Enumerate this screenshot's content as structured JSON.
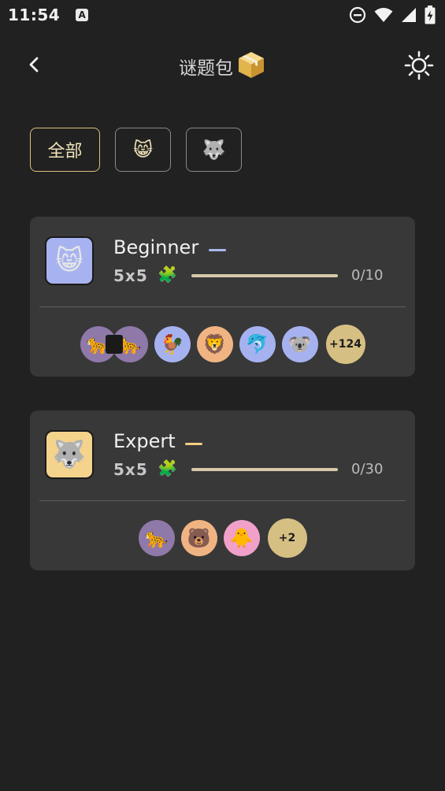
{
  "status_bar": {
    "time": "11:54",
    "notification_icon_letter": "A"
  },
  "header": {
    "title": "谜题包",
    "title_emoji": "📦"
  },
  "filters": [
    {
      "label": "全部",
      "active": true
    },
    {
      "label": "😸",
      "active": false
    },
    {
      "label": "🐺",
      "active": false
    }
  ],
  "packs": [
    {
      "name": "Beginner",
      "icon": "😸",
      "icon_bg": "#a7b3f0",
      "accent": "#a9b7ee",
      "size": "5x5",
      "puzzle_icon": "🧩",
      "progress_text": "0/10",
      "progress": 0,
      "animals": [
        {
          "emoji": "🐆",
          "bg": "#8e79a9"
        },
        {
          "emoji": "🐆",
          "bg": "#8e79a9"
        },
        {
          "emoji": "🐓",
          "bg": "#a6b2f0"
        },
        {
          "emoji": "🦁",
          "bg": "#f0b483"
        },
        {
          "emoji": "🐬",
          "bg": "#a6b2f0"
        },
        {
          "emoji": "🐨",
          "bg": "#a6b2f0"
        }
      ],
      "more_label": "+124"
    },
    {
      "name": "Expert",
      "icon": "🐺",
      "icon_bg": "#f4d38c",
      "accent": "#f1cf84",
      "size": "5x5",
      "puzzle_icon": "🧩",
      "progress_text": "0/30",
      "progress": 0,
      "animals": [
        {
          "emoji": "🐆",
          "bg": "#8e79a9"
        },
        {
          "emoji": "🐻",
          "bg": "#f0b483"
        },
        {
          "emoji": "🐥",
          "bg": "#f0a0c9"
        }
      ],
      "more_label": "+2"
    }
  ]
}
